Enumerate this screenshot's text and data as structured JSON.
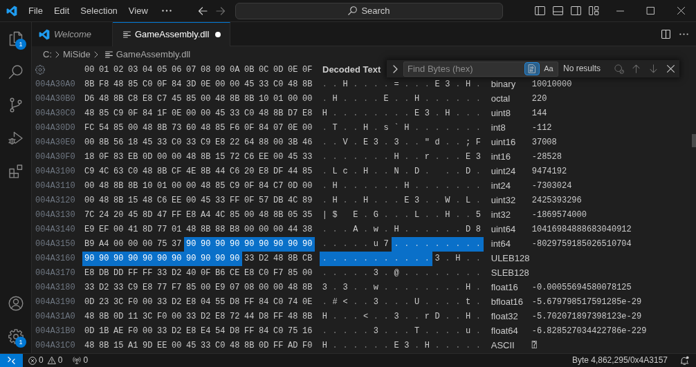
{
  "title_bar": {
    "menu": [
      "File",
      "Edit",
      "Selection",
      "View"
    ],
    "nav": [
      {
        "kind": "back",
        "disabled": false
      },
      {
        "kind": "forward",
        "disabled": true
      }
    ],
    "search": {
      "label": "Search"
    }
  },
  "activity_bar": {
    "items": [
      {
        "kind": "explorer",
        "badge": "1"
      },
      {
        "kind": "search"
      },
      {
        "kind": "source_control"
      },
      {
        "kind": "run_debug"
      },
      {
        "kind": "extensions"
      }
    ],
    "bottom_items": [
      {
        "kind": "accounts"
      },
      {
        "kind": "manage",
        "badge": "1"
      }
    ]
  },
  "tabs": [
    {
      "kind": "welcome",
      "label": "Welcome",
      "selected": false,
      "preview": true,
      "dirty": false
    },
    {
      "kind": "file",
      "label": "GameAssembly.dll",
      "selected": true,
      "preview": false,
      "dirty": true
    }
  ],
  "breadcrumbs": [
    {
      "kind": "folder",
      "label": "C:"
    },
    {
      "kind": "folder",
      "label": "MiSide"
    },
    {
      "kind": "file",
      "label": "GameAssembly.dll"
    }
  ],
  "hex_view": {
    "columns": [
      "00",
      "01",
      "02",
      "03",
      "04",
      "05",
      "06",
      "07",
      "08",
      "09",
      "0A",
      "0B",
      "0C",
      "0D",
      "0E",
      "0F"
    ],
    "decoded_title": "Decoded Text",
    "rows": [
      {
        "address": "004A30A0",
        "bytes": [
          {
            "hex": "8B",
            "char": ".",
            "selected": false
          },
          {
            "hex": "F8",
            "char": ".",
            "selected": false
          },
          {
            "hex": "48",
            "char": "H",
            "selected": false
          },
          {
            "hex": "85",
            "char": ".",
            "selected": false
          },
          {
            "hex": "C0",
            "char": ".",
            "selected": false
          },
          {
            "hex": "0F",
            "char": ".",
            "selected": false
          },
          {
            "hex": "84",
            "char": ".",
            "selected": false
          },
          {
            "hex": "3D",
            "char": "=",
            "selected": false
          },
          {
            "hex": "0E",
            "char": ".",
            "selected": false
          },
          {
            "hex": "00",
            "char": ".",
            "selected": false
          },
          {
            "hex": "00",
            "char": ".",
            "selected": false
          },
          {
            "hex": "45",
            "char": "E",
            "selected": false
          },
          {
            "hex": "33",
            "char": "3",
            "selected": false
          },
          {
            "hex": "C0",
            "char": ".",
            "selected": false
          },
          {
            "hex": "48",
            "char": "H",
            "selected": false
          },
          {
            "hex": "8B",
            "char": ".",
            "selected": false
          }
        ]
      },
      {
        "address": "004A30B0",
        "bytes": [
          {
            "hex": "D6",
            "char": ".",
            "selected": false
          },
          {
            "hex": "48",
            "char": "H",
            "selected": false
          },
          {
            "hex": "8B",
            "char": ".",
            "selected": false
          },
          {
            "hex": "C8",
            "char": ".",
            "selected": false
          },
          {
            "hex": "E8",
            "char": ".",
            "selected": false
          },
          {
            "hex": "C7",
            "char": ".",
            "selected": false
          },
          {
            "hex": "45",
            "char": "E",
            "selected": false
          },
          {
            "hex": "85",
            "char": ".",
            "selected": false
          },
          {
            "hex": "00",
            "char": ".",
            "selected": false
          },
          {
            "hex": "48",
            "char": "H",
            "selected": false
          },
          {
            "hex": "8B",
            "char": ".",
            "selected": false
          },
          {
            "hex": "8B",
            "char": ".",
            "selected": false
          },
          {
            "hex": "10",
            "char": ".",
            "selected": false
          },
          {
            "hex": "01",
            "char": ".",
            "selected": false
          },
          {
            "hex": "00",
            "char": ".",
            "selected": false
          },
          {
            "hex": "00",
            "char": ".",
            "selected": false
          }
        ]
      },
      {
        "address": "004A30C0",
        "bytes": [
          {
            "hex": "48",
            "char": "H",
            "selected": false
          },
          {
            "hex": "85",
            "char": ".",
            "selected": false
          },
          {
            "hex": "C9",
            "char": ".",
            "selected": false
          },
          {
            "hex": "0F",
            "char": ".",
            "selected": false
          },
          {
            "hex": "84",
            "char": ".",
            "selected": false
          },
          {
            "hex": "1F",
            "char": ".",
            "selected": false
          },
          {
            "hex": "0E",
            "char": ".",
            "selected": false
          },
          {
            "hex": "00",
            "char": ".",
            "selected": false
          },
          {
            "hex": "00",
            "char": ".",
            "selected": false
          },
          {
            "hex": "45",
            "char": "E",
            "selected": false
          },
          {
            "hex": "33",
            "char": "3",
            "selected": false
          },
          {
            "hex": "C0",
            "char": ".",
            "selected": false
          },
          {
            "hex": "48",
            "char": "H",
            "selected": false
          },
          {
            "hex": "8B",
            "char": ".",
            "selected": false
          },
          {
            "hex": "D7",
            "char": ".",
            "selected": false
          },
          {
            "hex": "E8",
            "char": ".",
            "selected": false
          }
        ]
      },
      {
        "address": "004A30D0",
        "bytes": [
          {
            "hex": "FC",
            "char": ".",
            "selected": false
          },
          {
            "hex": "54",
            "char": "T",
            "selected": false
          },
          {
            "hex": "85",
            "char": ".",
            "selected": false
          },
          {
            "hex": "00",
            "char": ".",
            "selected": false
          },
          {
            "hex": "48",
            "char": "H",
            "selected": false
          },
          {
            "hex": "8B",
            "char": ".",
            "selected": false
          },
          {
            "hex": "73",
            "char": "s",
            "selected": false
          },
          {
            "hex": "60",
            "char": "`",
            "selected": false
          },
          {
            "hex": "48",
            "char": "H",
            "selected": false
          },
          {
            "hex": "85",
            "char": ".",
            "selected": false
          },
          {
            "hex": "F6",
            "char": ".",
            "selected": false
          },
          {
            "hex": "0F",
            "char": ".",
            "selected": false
          },
          {
            "hex": "84",
            "char": ".",
            "selected": false
          },
          {
            "hex": "07",
            "char": ".",
            "selected": false
          },
          {
            "hex": "0E",
            "char": ".",
            "selected": false
          },
          {
            "hex": "00",
            "char": ".",
            "selected": false
          }
        ]
      },
      {
        "address": "004A30E0",
        "bytes": [
          {
            "hex": "00",
            "char": ".",
            "selected": false
          },
          {
            "hex": "8B",
            "char": ".",
            "selected": false
          },
          {
            "hex": "56",
            "char": "V",
            "selected": false
          },
          {
            "hex": "18",
            "char": ".",
            "selected": false
          },
          {
            "hex": "45",
            "char": "E",
            "selected": false
          },
          {
            "hex": "33",
            "char": "3",
            "selected": false
          },
          {
            "hex": "C0",
            "char": ".",
            "selected": false
          },
          {
            "hex": "33",
            "char": "3",
            "selected": false
          },
          {
            "hex": "C9",
            "char": ".",
            "selected": false
          },
          {
            "hex": "E8",
            "char": ".",
            "selected": false
          },
          {
            "hex": "22",
            "char": "\"",
            "selected": false
          },
          {
            "hex": "64",
            "char": "d",
            "selected": false
          },
          {
            "hex": "88",
            "char": ".",
            "selected": false
          },
          {
            "hex": "00",
            "char": ".",
            "selected": false
          },
          {
            "hex": "3B",
            "char": ";",
            "selected": false
          },
          {
            "hex": "46",
            "char": "F",
            "selected": false
          }
        ]
      },
      {
        "address": "004A30F0",
        "bytes": [
          {
            "hex": "18",
            "char": ".",
            "selected": false
          },
          {
            "hex": "0F",
            "char": ".",
            "selected": false
          },
          {
            "hex": "83",
            "char": ".",
            "selected": false
          },
          {
            "hex": "EB",
            "char": ".",
            "selected": false
          },
          {
            "hex": "0D",
            "char": ".",
            "selected": false
          },
          {
            "hex": "00",
            "char": ".",
            "selected": false
          },
          {
            "hex": "00",
            "char": ".",
            "selected": false
          },
          {
            "hex": "48",
            "char": "H",
            "selected": false
          },
          {
            "hex": "8B",
            "char": ".",
            "selected": false
          },
          {
            "hex": "15",
            "char": ".",
            "selected": false
          },
          {
            "hex": "72",
            "char": "r",
            "selected": false
          },
          {
            "hex": "C6",
            "char": ".",
            "selected": false
          },
          {
            "hex": "EE",
            "char": ".",
            "selected": false
          },
          {
            "hex": "00",
            "char": ".",
            "selected": false
          },
          {
            "hex": "45",
            "char": "E",
            "selected": false
          },
          {
            "hex": "33",
            "char": "3",
            "selected": false
          }
        ]
      },
      {
        "address": "004A3100",
        "bytes": [
          {
            "hex": "C9",
            "char": ".",
            "selected": false
          },
          {
            "hex": "4C",
            "char": "L",
            "selected": false
          },
          {
            "hex": "63",
            "char": "c",
            "selected": false
          },
          {
            "hex": "C0",
            "char": ".",
            "selected": false
          },
          {
            "hex": "48",
            "char": "H",
            "selected": false
          },
          {
            "hex": "8B",
            "char": ".",
            "selected": false
          },
          {
            "hex": "CF",
            "char": ".",
            "selected": false
          },
          {
            "hex": "4E",
            "char": "N",
            "selected": false
          },
          {
            "hex": "8B",
            "char": ".",
            "selected": false
          },
          {
            "hex": "44",
            "char": "D",
            "selected": false
          },
          {
            "hex": "C6",
            "char": ".",
            "selected": false
          },
          {
            "hex": "20",
            "selected": false
          },
          {
            "hex": "E8",
            "char": ".",
            "selected": false
          },
          {
            "hex": "DF",
            "char": ".",
            "selected": false
          },
          {
            "hex": "44",
            "char": "D",
            "selected": false
          },
          {
            "hex": "85",
            "char": ".",
            "selected": false
          }
        ]
      },
      {
        "address": "004A3110",
        "bytes": [
          {
            "hex": "00",
            "char": ".",
            "selected": false
          },
          {
            "hex": "48",
            "char": "H",
            "selected": false
          },
          {
            "hex": "8B",
            "char": ".",
            "selected": false
          },
          {
            "hex": "8B",
            "char": ".",
            "selected": false
          },
          {
            "hex": "10",
            "char": ".",
            "selected": false
          },
          {
            "hex": "01",
            "char": ".",
            "selected": false
          },
          {
            "hex": "00",
            "char": ".",
            "selected": false
          },
          {
            "hex": "00",
            "char": ".",
            "selected": false
          },
          {
            "hex": "48",
            "char": "H",
            "selected": false
          },
          {
            "hex": "85",
            "char": ".",
            "selected": false
          },
          {
            "hex": "C9",
            "char": ".",
            "selected": false
          },
          {
            "hex": "0F",
            "char": ".",
            "selected": false
          },
          {
            "hex": "84",
            "char": ".",
            "selected": false
          },
          {
            "hex": "C7",
            "char": ".",
            "selected": false
          },
          {
            "hex": "0D",
            "char": ".",
            "selected": false
          },
          {
            "hex": "00",
            "char": ".",
            "selected": false
          }
        ]
      },
      {
        "address": "004A3120",
        "bytes": [
          {
            "hex": "00",
            "char": ".",
            "selected": false
          },
          {
            "hex": "48",
            "char": "H",
            "selected": false
          },
          {
            "hex": "8B",
            "char": ".",
            "selected": false
          },
          {
            "hex": "15",
            "char": ".",
            "selected": false
          },
          {
            "hex": "48",
            "char": "H",
            "selected": false
          },
          {
            "hex": "C6",
            "char": ".",
            "selected": false
          },
          {
            "hex": "EE",
            "char": ".",
            "selected": false
          },
          {
            "hex": "00",
            "char": ".",
            "selected": false
          },
          {
            "hex": "45",
            "char": "E",
            "selected": false
          },
          {
            "hex": "33",
            "char": "3",
            "selected": false
          },
          {
            "hex": "FF",
            "char": ".",
            "selected": false
          },
          {
            "hex": "0F",
            "char": ".",
            "selected": false
          },
          {
            "hex": "57",
            "char": "W",
            "selected": false
          },
          {
            "hex": "DB",
            "char": ".",
            "selected": false
          },
          {
            "hex": "4C",
            "char": "L",
            "selected": false
          },
          {
            "hex": "89",
            "char": ".",
            "selected": false
          }
        ]
      },
      {
        "address": "004A3130",
        "bytes": [
          {
            "hex": "7C",
            "char": "|",
            "selected": false
          },
          {
            "hex": "24",
            "char": "$",
            "selected": false
          },
          {
            "hex": "20",
            "selected": false
          },
          {
            "hex": "45",
            "char": "E",
            "selected": false
          },
          {
            "hex": "8D",
            "char": ".",
            "selected": false
          },
          {
            "hex": "47",
            "char": "G",
            "selected": false
          },
          {
            "hex": "FF",
            "char": ".",
            "selected": false
          },
          {
            "hex": "E8",
            "char": ".",
            "selected": false
          },
          {
            "hex": "A4",
            "char": ".",
            "selected": false
          },
          {
            "hex": "4C",
            "char": "L",
            "selected": false
          },
          {
            "hex": "85",
            "char": ".",
            "selected": false
          },
          {
            "hex": "00",
            "char": ".",
            "selected": false
          },
          {
            "hex": "48",
            "char": "H",
            "selected": false
          },
          {
            "hex": "8B",
            "char": ".",
            "selected": false
          },
          {
            "hex": "05",
            "char": ".",
            "selected": false
          },
          {
            "hex": "35",
            "char": "5",
            "selected": false
          }
        ]
      },
      {
        "address": "004A3140",
        "bytes": [
          {
            "hex": "E9",
            "char": ".",
            "selected": false
          },
          {
            "hex": "EF",
            "char": ".",
            "selected": false
          },
          {
            "hex": "00",
            "char": ".",
            "selected": false
          },
          {
            "hex": "41",
            "char": "A",
            "selected": false
          },
          {
            "hex": "8D",
            "char": ".",
            "selected": false
          },
          {
            "hex": "77",
            "char": "w",
            "selected": false
          },
          {
            "hex": "01",
            "char": ".",
            "selected": false
          },
          {
            "hex": "48",
            "char": "H",
            "selected": false
          },
          {
            "hex": "8B",
            "char": ".",
            "selected": false
          },
          {
            "hex": "88",
            "char": ".",
            "selected": false
          },
          {
            "hex": "B8",
            "char": ".",
            "selected": false
          },
          {
            "hex": "00",
            "char": ".",
            "selected": false
          },
          {
            "hex": "00",
            "char": ".",
            "selected": false
          },
          {
            "hex": "00",
            "char": ".",
            "selected": false
          },
          {
            "hex": "44",
            "char": "D",
            "selected": false
          },
          {
            "hex": "38",
            "char": "8",
            "selected": false
          }
        ]
      },
      {
        "address": "004A3150",
        "bytes": [
          {
            "hex": "B9",
            "char": ".",
            "selected": false
          },
          {
            "hex": "A4",
            "char": ".",
            "selected": false
          },
          {
            "hex": "00",
            "char": ".",
            "selected": false
          },
          {
            "hex": "00",
            "char": ".",
            "selected": false
          },
          {
            "hex": "00",
            "char": ".",
            "selected": false
          },
          {
            "hex": "75",
            "char": "u",
            "selected": false
          },
          {
            "hex": "37",
            "char": "7",
            "selected": false
          },
          {
            "hex": "90",
            "char": ".",
            "selected": true
          },
          {
            "hex": "90",
            "char": ".",
            "selected": true
          },
          {
            "hex": "90",
            "char": ".",
            "selected": true
          },
          {
            "hex": "90",
            "char": ".",
            "selected": true
          },
          {
            "hex": "90",
            "char": ".",
            "selected": true
          },
          {
            "hex": "90",
            "char": ".",
            "selected": true
          },
          {
            "hex": "90",
            "char": ".",
            "selected": true
          },
          {
            "hex": "90",
            "char": ".",
            "selected": true
          },
          {
            "hex": "90",
            "char": ".",
            "selected": true
          }
        ]
      },
      {
        "address": "004A3160",
        "bytes": [
          {
            "hex": "90",
            "char": ".",
            "selected": true
          },
          {
            "hex": "90",
            "char": ".",
            "selected": true
          },
          {
            "hex": "90",
            "char": ".",
            "selected": true
          },
          {
            "hex": "90",
            "char": ".",
            "selected": true
          },
          {
            "hex": "90",
            "char": ".",
            "selected": true
          },
          {
            "hex": "90",
            "char": ".",
            "selected": true
          },
          {
            "hex": "90",
            "char": ".",
            "selected": true
          },
          {
            "hex": "90",
            "char": ".",
            "selected": true
          },
          {
            "hex": "90",
            "char": ".",
            "selected": true
          },
          {
            "hex": "90",
            "char": ".",
            "selected": true
          },
          {
            "hex": "90",
            "char": ".",
            "selected": true
          },
          {
            "hex": "33",
            "char": "3",
            "selected": false
          },
          {
            "hex": "D2",
            "char": ".",
            "selected": false
          },
          {
            "hex": "48",
            "char": "H",
            "selected": false
          },
          {
            "hex": "8B",
            "char": ".",
            "selected": false
          },
          {
            "hex": "CB",
            "char": ".",
            "selected": false
          }
        ]
      },
      {
        "address": "004A3170",
        "bytes": [
          {
            "hex": "E8",
            "char": ".",
            "selected": false
          },
          {
            "hex": "DB",
            "char": ".",
            "selected": false
          },
          {
            "hex": "DD",
            "char": ".",
            "selected": false
          },
          {
            "hex": "FF",
            "char": ".",
            "selected": false
          },
          {
            "hex": "FF",
            "char": ".",
            "selected": false
          },
          {
            "hex": "33",
            "char": "3",
            "selected": false
          },
          {
            "hex": "D2",
            "char": ".",
            "selected": false
          },
          {
            "hex": "40",
            "char": "@",
            "selected": false
          },
          {
            "hex": "0F",
            "char": ".",
            "selected": false
          },
          {
            "hex": "B6",
            "char": ".",
            "selected": false
          },
          {
            "hex": "CE",
            "char": ".",
            "selected": false
          },
          {
            "hex": "E8",
            "char": ".",
            "selected": false
          },
          {
            "hex": "C0",
            "char": ".",
            "selected": false
          },
          {
            "hex": "F7",
            "char": ".",
            "selected": false
          },
          {
            "hex": "85",
            "char": ".",
            "selected": false
          },
          {
            "hex": "00",
            "char": ".",
            "selected": false
          }
        ]
      },
      {
        "address": "004A3180",
        "bytes": [
          {
            "hex": "33",
            "char": "3",
            "selected": false
          },
          {
            "hex": "D2",
            "char": ".",
            "selected": false
          },
          {
            "hex": "33",
            "char": "3",
            "selected": false
          },
          {
            "hex": "C9",
            "char": ".",
            "selected": false
          },
          {
            "hex": "E8",
            "char": ".",
            "selected": false
          },
          {
            "hex": "77",
            "char": "w",
            "selected": false
          },
          {
            "hex": "F7",
            "char": ".",
            "selected": false
          },
          {
            "hex": "85",
            "char": ".",
            "selected": false
          },
          {
            "hex": "00",
            "char": ".",
            "selected": false
          },
          {
            "hex": "E9",
            "char": ".",
            "selected": false
          },
          {
            "hex": "07",
            "char": ".",
            "selected": false
          },
          {
            "hex": "08",
            "char": ".",
            "selected": false
          },
          {
            "hex": "00",
            "char": ".",
            "selected": false
          },
          {
            "hex": "00",
            "char": ".",
            "selected": false
          },
          {
            "hex": "48",
            "char": "H",
            "selected": false
          },
          {
            "hex": "8B",
            "char": ".",
            "selected": false
          }
        ]
      },
      {
        "address": "004A3190",
        "bytes": [
          {
            "hex": "0D",
            "char": ".",
            "selected": false
          },
          {
            "hex": "23",
            "char": "#",
            "selected": false
          },
          {
            "hex": "3C",
            "char": "<",
            "selected": false
          },
          {
            "hex": "F0",
            "char": ".",
            "selected": false
          },
          {
            "hex": "00",
            "char": ".",
            "selected": false
          },
          {
            "hex": "33",
            "char": "3",
            "selected": false
          },
          {
            "hex": "D2",
            "char": ".",
            "selected": false
          },
          {
            "hex": "E8",
            "char": ".",
            "selected": false
          },
          {
            "hex": "04",
            "char": ".",
            "selected": false
          },
          {
            "hex": "55",
            "char": "U",
            "selected": false
          },
          {
            "hex": "D8",
            "char": ".",
            "selected": false
          },
          {
            "hex": "FF",
            "char": ".",
            "selected": false
          },
          {
            "hex": "84",
            "char": ".",
            "selected": false
          },
          {
            "hex": "C0",
            "char": ".",
            "selected": false
          },
          {
            "hex": "74",
            "char": "t",
            "selected": false
          },
          {
            "hex": "0E",
            "char": ".",
            "selected": false
          }
        ]
      },
      {
        "address": "004A31A0",
        "bytes": [
          {
            "hex": "48",
            "char": "H",
            "selected": false
          },
          {
            "hex": "8B",
            "char": ".",
            "selected": false
          },
          {
            "hex": "0D",
            "char": ".",
            "selected": false
          },
          {
            "hex": "11",
            "char": ".",
            "selected": false
          },
          {
            "hex": "3C",
            "char": "<",
            "selected": false
          },
          {
            "hex": "F0",
            "char": ".",
            "selected": false
          },
          {
            "hex": "00",
            "char": ".",
            "selected": false
          },
          {
            "hex": "33",
            "char": "3",
            "selected": false
          },
          {
            "hex": "D2",
            "char": ".",
            "selected": false
          },
          {
            "hex": "E8",
            "char": ".",
            "selected": false
          },
          {
            "hex": "72",
            "char": "r",
            "selected": false
          },
          {
            "hex": "44",
            "char": "D",
            "selected": false
          },
          {
            "hex": "D8",
            "char": ".",
            "selected": false
          },
          {
            "hex": "FF",
            "char": ".",
            "selected": false
          },
          {
            "hex": "48",
            "char": "H",
            "selected": false
          },
          {
            "hex": "8B",
            "char": ".",
            "selected": false
          }
        ]
      },
      {
        "address": "004A31B0",
        "bytes": [
          {
            "hex": "0D",
            "char": ".",
            "selected": false
          },
          {
            "hex": "1B",
            "char": ".",
            "selected": false
          },
          {
            "hex": "AE",
            "char": ".",
            "selected": false
          },
          {
            "hex": "F0",
            "char": ".",
            "selected": false
          },
          {
            "hex": "00",
            "char": ".",
            "selected": false
          },
          {
            "hex": "33",
            "char": "3",
            "selected": false
          },
          {
            "hex": "D2",
            "char": ".",
            "selected": false
          },
          {
            "hex": "E8",
            "char": ".",
            "selected": false
          },
          {
            "hex": "E4",
            "char": ".",
            "selected": false
          },
          {
            "hex": "54",
            "char": "T",
            "selected": false
          },
          {
            "hex": "D8",
            "char": ".",
            "selected": false
          },
          {
            "hex": "FF",
            "char": ".",
            "selected": false
          },
          {
            "hex": "84",
            "char": ".",
            "selected": false
          },
          {
            "hex": "C0",
            "char": ".",
            "selected": false
          },
          {
            "hex": "75",
            "char": "u",
            "selected": false
          },
          {
            "hex": "16",
            "char": ".",
            "selected": false
          }
        ]
      },
      {
        "address": "004A31C0",
        "bytes": [
          {
            "hex": "48",
            "char": "H",
            "selected": false
          },
          {
            "hex": "8B",
            "char": ".",
            "selected": false
          },
          {
            "hex": "15",
            "char": ".",
            "selected": false
          },
          {
            "hex": "A1",
            "char": ".",
            "selected": false
          },
          {
            "hex": "9D",
            "char": ".",
            "selected": false
          },
          {
            "hex": "EE",
            "char": ".",
            "selected": false
          },
          {
            "hex": "00",
            "char": ".",
            "selected": false
          },
          {
            "hex": "45",
            "char": "E",
            "selected": false
          },
          {
            "hex": "33",
            "char": "3",
            "selected": false
          },
          {
            "hex": "C0",
            "char": ".",
            "selected": false
          },
          {
            "hex": "48",
            "char": "H",
            "selected": false
          },
          {
            "hex": "8B",
            "char": ".",
            "selected": false
          },
          {
            "hex": "0D",
            "char": ".",
            "selected": false
          },
          {
            "hex": "FF",
            "char": ".",
            "selected": false
          },
          {
            "hex": "AD",
            "char": ".",
            "selected": false
          },
          {
            "hex": "F0",
            "char": ".",
            "selected": false
          }
        ]
      }
    ]
  },
  "find_widget": {
    "placeholder": "Find Bytes (hex)",
    "toggles": [
      {
        "kind": "binary",
        "selected": true
      },
      {
        "kind": "match_case",
        "label": "Aa",
        "selected": false
      }
    ],
    "result": "No results",
    "actions": [
      {
        "kind": "search_selection",
        "disabled": true
      },
      {
        "kind": "previous",
        "disabled": true
      },
      {
        "kind": "next",
        "disabled": true
      },
      {
        "kind": "close",
        "disabled": false
      }
    ]
  },
  "data_inspector": [
    {
      "label": "binary",
      "value": "10010000"
    },
    {
      "label": "octal",
      "value": "220"
    },
    {
      "label": "uint8",
      "value": "144"
    },
    {
      "label": "int8",
      "value": "-112"
    },
    {
      "label": "uint16",
      "value": "37008"
    },
    {
      "label": "int16",
      "value": "-28528"
    },
    {
      "label": "uint24",
      "value": "9474192"
    },
    {
      "label": "int24",
      "value": "-7303024"
    },
    {
      "label": "uint32",
      "value": "2425393296"
    },
    {
      "label": "int32",
      "value": "-1869574000"
    },
    {
      "label": "uint64",
      "value": "10416984888683040912"
    },
    {
      "label": "int64",
      "value": "-8029759185026510704"
    },
    {
      "label": "ULEB128"
    },
    {
      "label": "SLEB128"
    },
    {
      "label": "float16",
      "value": "-0.00055694580078125"
    },
    {
      "label": "bfloat16",
      "value": "-5.679798517591285e-29"
    },
    {
      "label": "float32",
      "value": "-5.702071897398123e-29"
    },
    {
      "label": "float64",
      "value": "-6.828527034422786e-229"
    },
    {
      "label": "ASCII",
      "value": "⍰"
    }
  ],
  "status_bar": {
    "errors": "0",
    "warnings": "0",
    "ports": "0",
    "position": "Byte 4,862,295/0x4A3157"
  }
}
